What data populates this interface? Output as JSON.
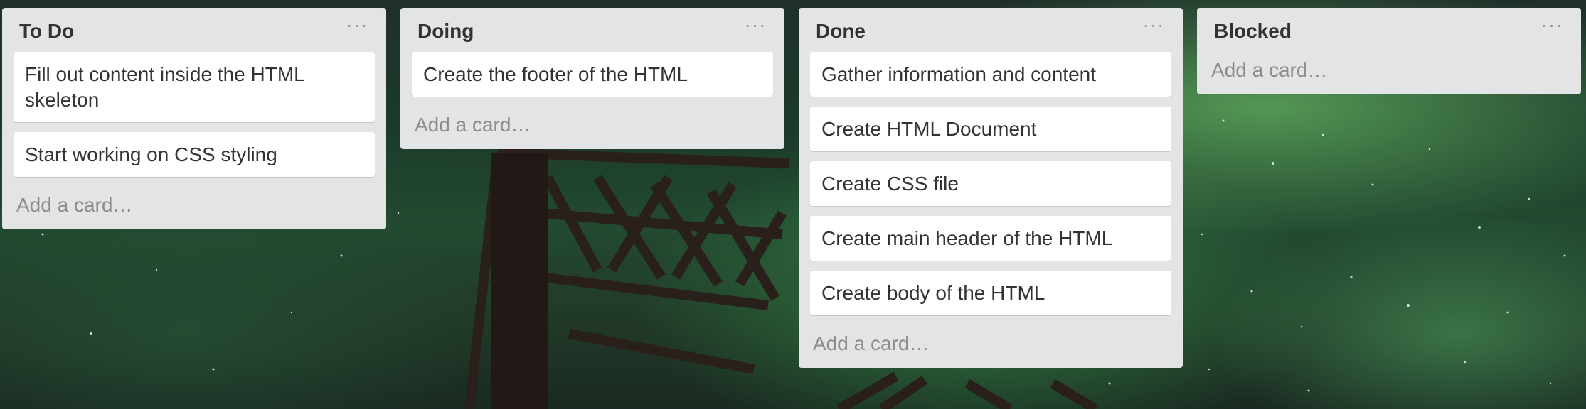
{
  "board": {
    "lists": [
      {
        "title": "To Do",
        "cards": [
          "Fill out content inside the HTML skeleton",
          "Start working on CSS styling"
        ],
        "add_card": "Add a card…"
      },
      {
        "title": "Doing",
        "cards": [
          "Create the footer of the HTML"
        ],
        "add_card": "Add a card…"
      },
      {
        "title": "Done",
        "cards": [
          "Gather information and content",
          "Create HTML Document",
          "Create CSS file",
          "Create main header of the HTML",
          "Create body of the HTML"
        ],
        "add_card": "Add a card…"
      },
      {
        "title": "Blocked",
        "cards": [],
        "add_card": "Add a card…"
      }
    ],
    "menu_glyph": "···",
    "list_menu_icon": "more-horizontal-icon",
    "colors": {
      "list_bg": "#e2e4e6",
      "card_bg": "#ffffff",
      "title_text": "#333333",
      "add_card_text": "#8c8c8c",
      "menu_icon": "#999999",
      "background_sky": "#1b3a2a",
      "aurora": "#7fe07a",
      "bridge": "#241c18"
    }
  }
}
